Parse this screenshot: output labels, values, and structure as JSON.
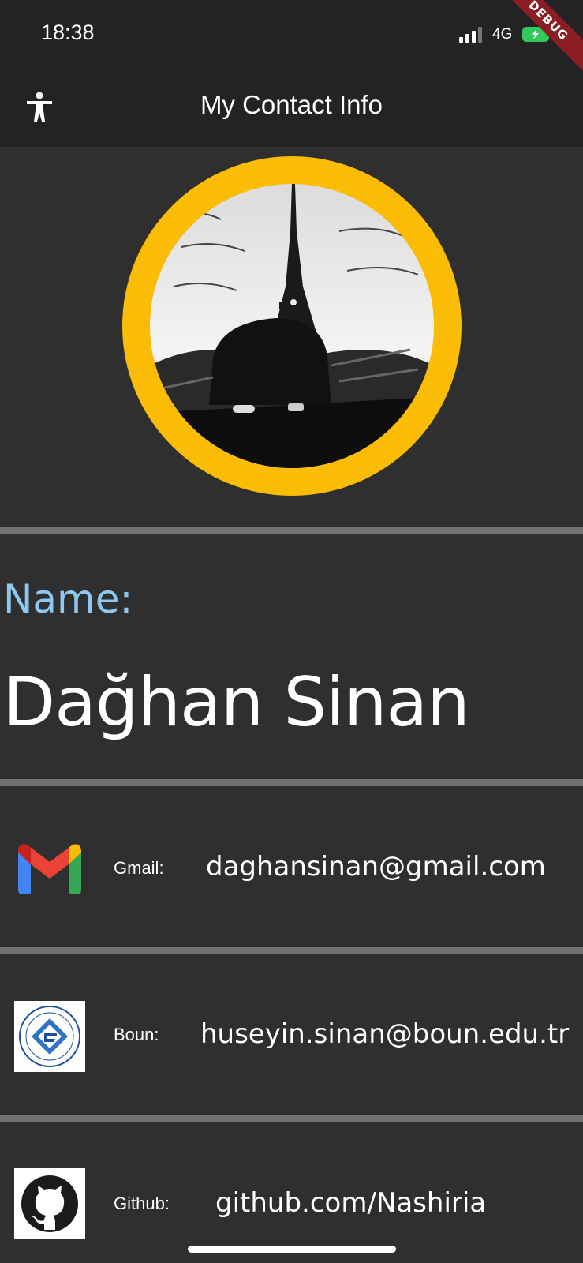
{
  "status": {
    "time": "18:38",
    "network": "4G",
    "debug_banner": "DEBUG"
  },
  "appbar": {
    "title": "My Contact Info",
    "accessibility_icon": "accessibility-icon"
  },
  "profile": {
    "avatar": "eiffel-tower-photo"
  },
  "name": {
    "label": "Name:",
    "value": "Dağhan Sinan"
  },
  "contacts": [
    {
      "label": "Gmail:",
      "value": "daghansinan@gmail.com",
      "icon": "gmail-icon"
    },
    {
      "label": "Boun:",
      "value": "huseyin.sinan@boun.edu.tr",
      "icon": "bogazici-logo"
    },
    {
      "label": "Github:",
      "value": "github.com/Nashiria",
      "icon": "github-icon"
    }
  ],
  "colors": {
    "accent_ring": "#fbbc05",
    "label_blue": "#8ec7f0",
    "background": "#2f2f2f",
    "bar": "#232323"
  }
}
